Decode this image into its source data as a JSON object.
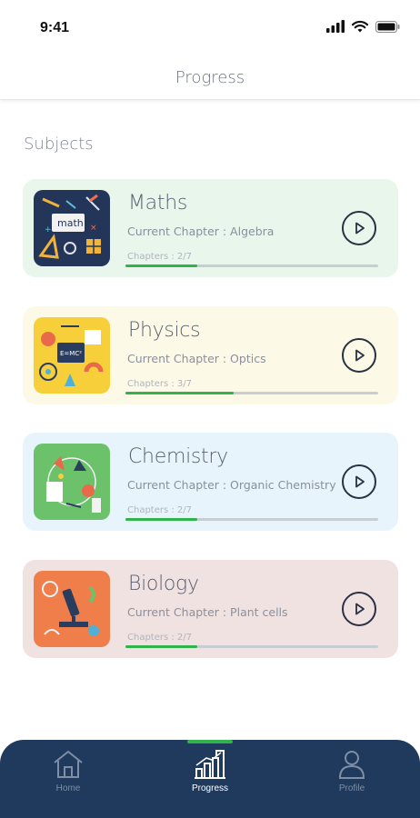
{
  "status_bar": {
    "time": "9:41"
  },
  "header": {
    "title": "Progress"
  },
  "section": {
    "title": "Subjects"
  },
  "subjects": [
    {
      "name": "Maths",
      "chapter": "Current Chapter : Algebra",
      "count": "Chapters : 2/7",
      "progress": 0.2857,
      "card_color": "#e9f6ec",
      "icon": "maths-thumbnail"
    },
    {
      "name": "Physics",
      "chapter": "Current Chapter : Optics",
      "count": "Chapters : 3/7",
      "progress": 0.4286,
      "card_color": "#fdf9e7",
      "icon": "physics-thumbnail"
    },
    {
      "name": "Chemistry",
      "chapter": "Current Chapter : Organic Chemistry",
      "count": "Chapters : 2/7",
      "progress": 0.2857,
      "card_color": "#e7f4fc",
      "icon": "chemistry-thumbnail"
    },
    {
      "name": "Biology",
      "chapter": "Current Chapter : Plant cells",
      "count": "Chapters : 2/7",
      "progress": 0.2857,
      "card_color": "#f1e2e2",
      "icon": "biology-thumbnail"
    }
  ],
  "tab_bar": {
    "tabs": [
      {
        "label": "Home",
        "icon": "home-icon",
        "active": false
      },
      {
        "label": "Progress",
        "icon": "progress-chart-icon",
        "active": true
      },
      {
        "label": "Profile",
        "icon": "profile-icon",
        "active": false
      }
    ]
  },
  "colors": {
    "accent": "#2fb34a",
    "tab_bar": "#1f3a5c"
  }
}
